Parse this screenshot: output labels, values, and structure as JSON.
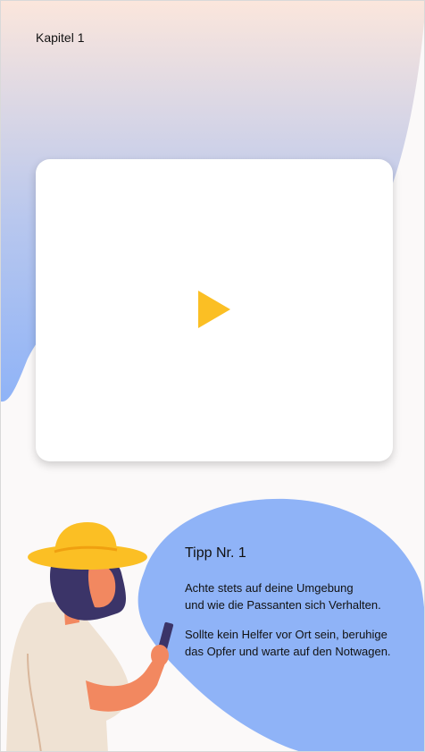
{
  "header": {
    "chapter_label": "Kapitel 1"
  },
  "video": {
    "play_icon": "play-icon",
    "accent_color": "#fbbf24"
  },
  "tip": {
    "title": "Tipp Nr. 1",
    "paragraph1_line1": "Achte stets auf deine Umgebung",
    "paragraph1_line2": "und wie die Passanten sich Verhalten.",
    "paragraph2_line1": "Sollte kein Helfer vor Ort sein, beruhige",
    "paragraph2_line2": "das Opfer und warte auf den Notwagen."
  },
  "colors": {
    "blob_blue": "#8fb3f7",
    "blob_peach": "#fbe6dc",
    "hat_yellow": "#fbbf24",
    "hair_dark": "#3b3468"
  }
}
